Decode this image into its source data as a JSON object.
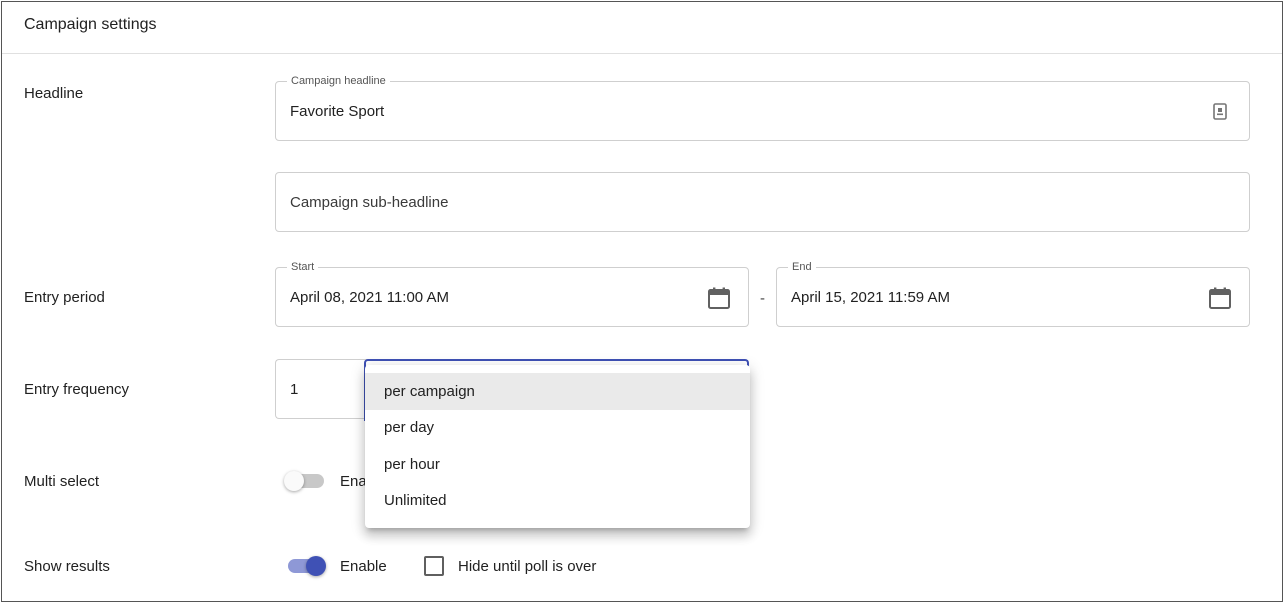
{
  "header": {
    "title": "Campaign settings"
  },
  "headline": {
    "label": "Headline",
    "campaign_headline": {
      "label": "Campaign headline",
      "value": "Favorite Sport"
    },
    "sub_headline": {
      "placeholder": "Campaign sub-headline"
    }
  },
  "entry_period": {
    "label": "Entry period",
    "start": {
      "label": "Start",
      "value": "April 08, 2021 11:00 AM"
    },
    "separator": "-",
    "end": {
      "label": "End",
      "value": "April 15, 2021 11:59 AM"
    }
  },
  "entry_frequency": {
    "label": "Entry frequency",
    "count": "1",
    "options": [
      "per campaign",
      "per day",
      "per hour",
      "Unlimited"
    ],
    "selected_index": 0
  },
  "multi_select": {
    "label": "Multi select",
    "toggle_label": "Ena",
    "enabled": false
  },
  "show_results": {
    "label": "Show results",
    "toggle_label": "Enable",
    "enabled": true,
    "hide_until_over_label": "Hide until poll is over",
    "hide_until_over_checked": false
  },
  "colors": {
    "accent": "#3f51b5",
    "accent_track": "#8e98d6",
    "border": "#cfcfcf",
    "highlight": "#eaeaea"
  },
  "icons": {
    "headline_field": "text-snippet-icon",
    "date_field": "calendar-icon"
  }
}
